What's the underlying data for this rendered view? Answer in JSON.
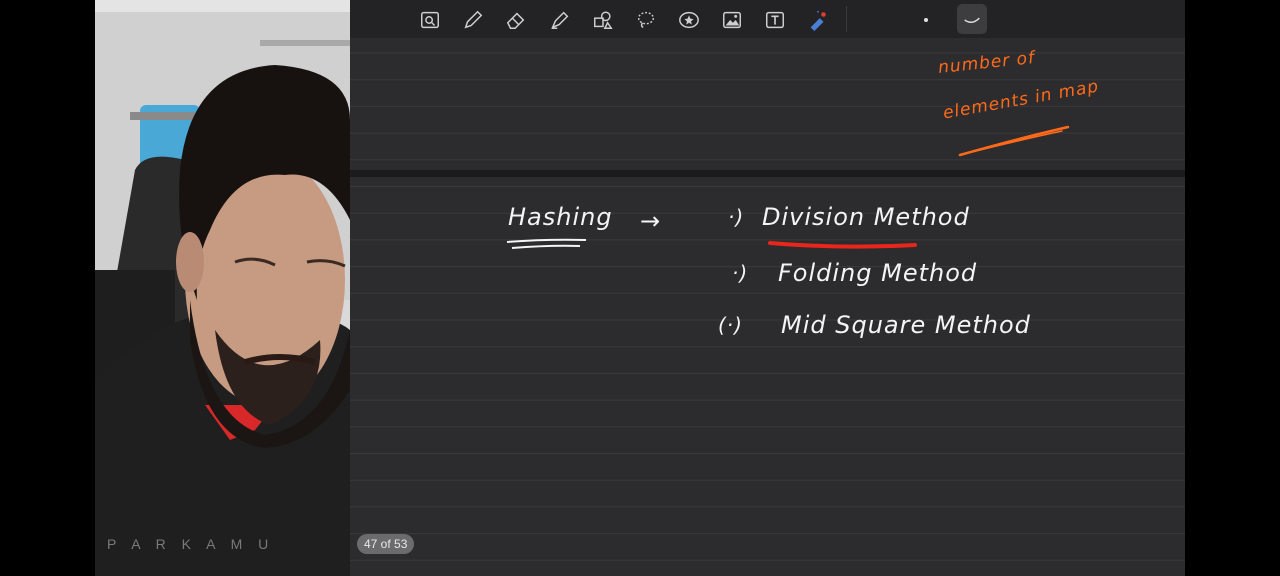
{
  "toolbar": {
    "tools": [
      {
        "name": "zoom-icon"
      },
      {
        "name": "pen-icon"
      },
      {
        "name": "eraser-icon"
      },
      {
        "name": "highlighter-icon"
      },
      {
        "name": "shapes-icon"
      },
      {
        "name": "lasso-icon"
      },
      {
        "name": "sticker-icon"
      },
      {
        "name": "image-icon"
      },
      {
        "name": "text-icon"
      },
      {
        "name": "laser-pointer-icon"
      }
    ],
    "active_pen_color": "#ffffff"
  },
  "notes": {
    "heading": "Hashing",
    "arrow": "→",
    "items": [
      {
        "bullet": "·)",
        "text": "Division Method"
      },
      {
        "bullet": "·)",
        "text": "Folding Method"
      },
      {
        "bullet": "(·)",
        "text": "Mid Square Method"
      }
    ],
    "annotation_line1": "number of",
    "annotation_line2": "elements in map"
  },
  "webcam": {
    "shirt_text": "P A R K A M U"
  },
  "page_indicator": "47 of 53",
  "colors": {
    "canvas": "#2c2c2e",
    "ink_white": "#f4f4f4",
    "ink_orange": "#ff6a1a",
    "ink_red": "#e8261c"
  }
}
